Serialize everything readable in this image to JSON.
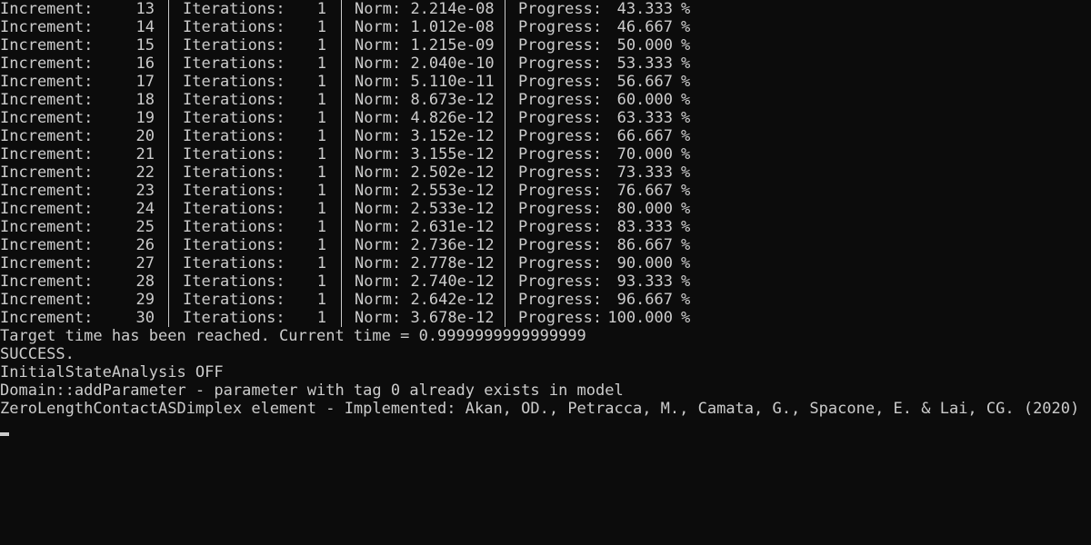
{
  "labels": {
    "increment": "Increment:",
    "iterations": "Iterations:",
    "norm": "Norm:",
    "progress": "Progress:",
    "percent": "%"
  },
  "rows": [
    {
      "increment": "13",
      "iterations": "1",
      "norm": "2.214e-08",
      "progress": "43.333"
    },
    {
      "increment": "14",
      "iterations": "1",
      "norm": "1.012e-08",
      "progress": "46.667"
    },
    {
      "increment": "15",
      "iterations": "1",
      "norm": "1.215e-09",
      "progress": "50.000"
    },
    {
      "increment": "16",
      "iterations": "1",
      "norm": "2.040e-10",
      "progress": "53.333"
    },
    {
      "increment": "17",
      "iterations": "1",
      "norm": "5.110e-11",
      "progress": "56.667"
    },
    {
      "increment": "18",
      "iterations": "1",
      "norm": "8.673e-12",
      "progress": "60.000"
    },
    {
      "increment": "19",
      "iterations": "1",
      "norm": "4.826e-12",
      "progress": "63.333"
    },
    {
      "increment": "20",
      "iterations": "1",
      "norm": "3.152e-12",
      "progress": "66.667"
    },
    {
      "increment": "21",
      "iterations": "1",
      "norm": "3.155e-12",
      "progress": "70.000"
    },
    {
      "increment": "22",
      "iterations": "1",
      "norm": "2.502e-12",
      "progress": "73.333"
    },
    {
      "increment": "23",
      "iterations": "1",
      "norm": "2.553e-12",
      "progress": "76.667"
    },
    {
      "increment": "24",
      "iterations": "1",
      "norm": "2.533e-12",
      "progress": "80.000"
    },
    {
      "increment": "25",
      "iterations": "1",
      "norm": "2.631e-12",
      "progress": "83.333"
    },
    {
      "increment": "26",
      "iterations": "1",
      "norm": "2.736e-12",
      "progress": "86.667"
    },
    {
      "increment": "27",
      "iterations": "1",
      "norm": "2.778e-12",
      "progress": "90.000"
    },
    {
      "increment": "28",
      "iterations": "1",
      "norm": "2.740e-12",
      "progress": "93.333"
    },
    {
      "increment": "29",
      "iterations": "1",
      "norm": "2.642e-12",
      "progress": "96.667"
    },
    {
      "increment": "30",
      "iterations": "1",
      "norm": "3.678e-12",
      "progress": "100.000"
    }
  ],
  "messages": [
    "Target time has been reached. Current time = 0.9999999999999999",
    "SUCCESS.",
    "InitialStateAnalysis OFF",
    "Domain::addParameter - parameter with tag 0 already exists in model",
    "ZeroLengthContactASDimplex element - Implemented: Akan, OD., Petracca, M., Camata, G., Spacone, E. & Lai, CG. (2020)"
  ],
  "colors": {
    "background": "#0c0c0c",
    "foreground": "#cccccc"
  }
}
